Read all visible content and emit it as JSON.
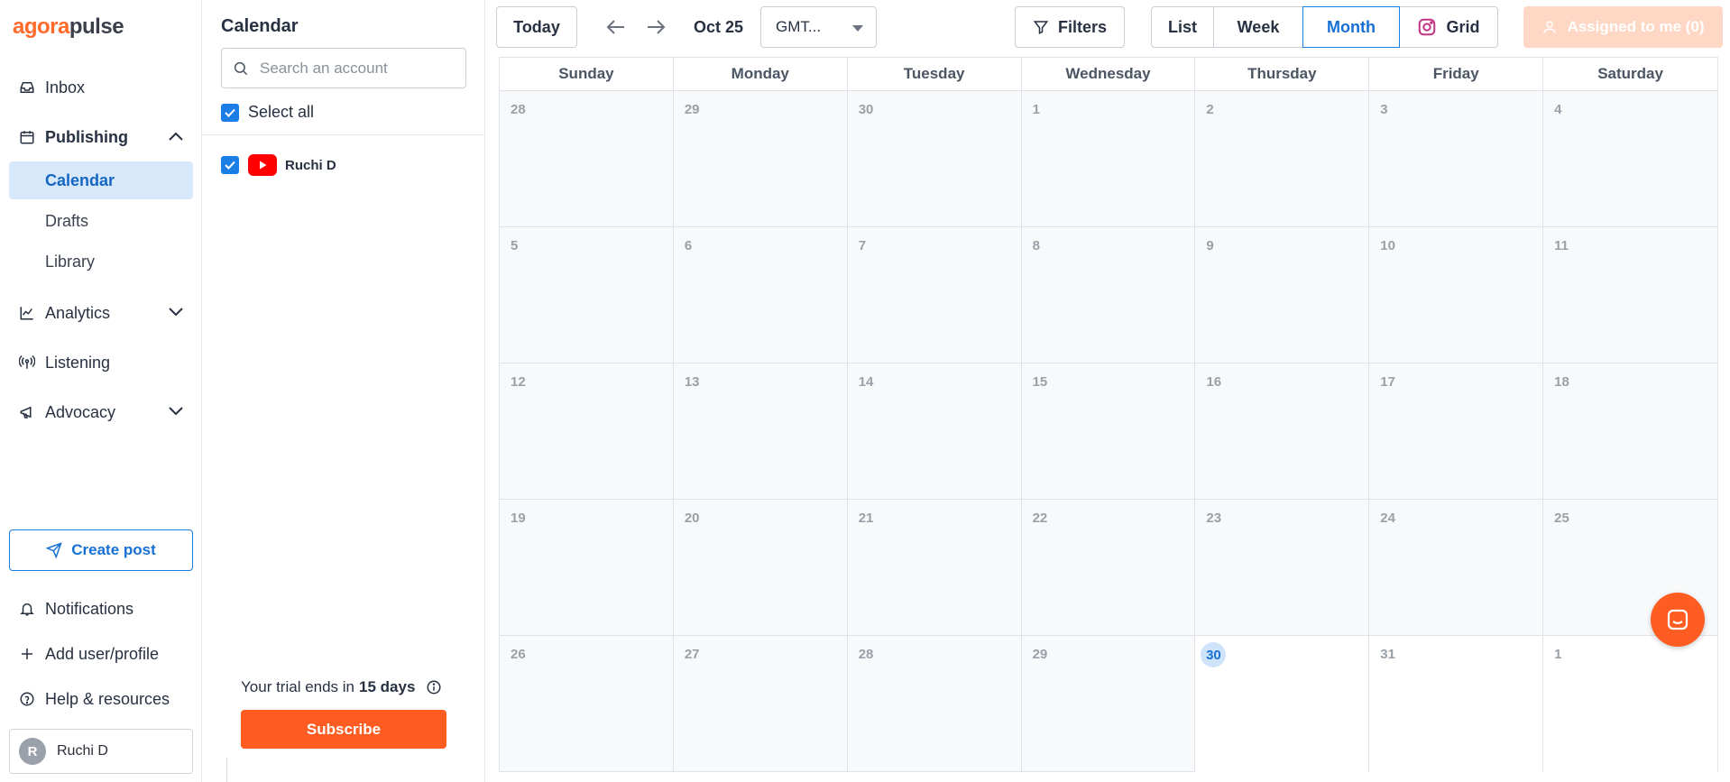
{
  "brand": {
    "part1": "agora",
    "part2": "pulse"
  },
  "nav": {
    "inbox": "Inbox",
    "publishing": "Publishing",
    "calendar": "Calendar",
    "drafts": "Drafts",
    "library": "Library",
    "analytics": "Analytics",
    "listening": "Listening",
    "advocacy": "Advocacy",
    "create_post": "Create post",
    "notifications": "Notifications",
    "add_user": "Add user/profile",
    "help": "Help & resources",
    "user_initial": "R",
    "user_name": "Ruchi D"
  },
  "panel": {
    "title": "Calendar",
    "search_placeholder": "Search an account",
    "select_all": "Select all",
    "account_name": "Ruchi D",
    "trial_prefix": "Your trial ends in",
    "trial_days": "15 days",
    "subscribe": "Subscribe"
  },
  "toolbar": {
    "today": "Today",
    "date": "Oct 25",
    "timezone": "GMT...",
    "filters": "Filters",
    "views": {
      "list": "List",
      "week": "Week",
      "month": "Month",
      "grid": "Grid"
    },
    "active_view": "Month",
    "assigned": "Assigned to me (0)"
  },
  "calendar": {
    "weekdays": [
      "Sunday",
      "Monday",
      "Tuesday",
      "Wednesday",
      "Thursday",
      "Friday",
      "Saturday"
    ],
    "days": [
      "28",
      "29",
      "30",
      "1",
      "2",
      "3",
      "4",
      "5",
      "6",
      "7",
      "8",
      "9",
      "10",
      "11",
      "12",
      "13",
      "14",
      "15",
      "16",
      "17",
      "18",
      "19",
      "20",
      "21",
      "22",
      "23",
      "24",
      "25",
      "26",
      "27",
      "28",
      "29",
      "30",
      "31",
      "1"
    ],
    "today": "30"
  },
  "colors": {
    "brand_orange": "#ff5c21",
    "accent_blue": "#1a7ee6",
    "active_nav_bg": "#d7e8fb"
  }
}
